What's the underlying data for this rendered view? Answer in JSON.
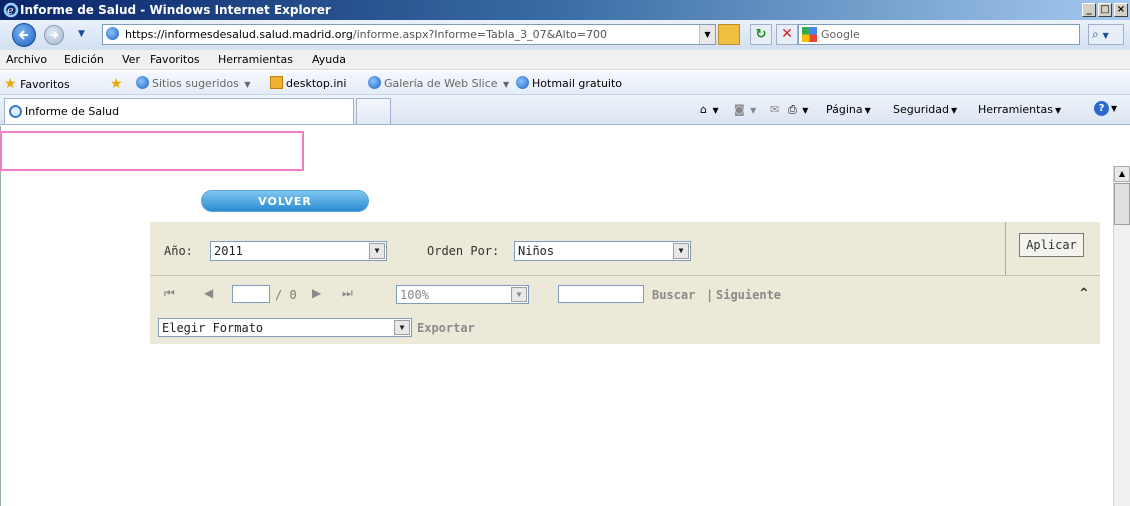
{
  "window": {
    "title": "Informe de Salud - Windows Internet Explorer"
  },
  "address": {
    "host": "https://informesdesalud.salud.madrid.org",
    "path": "/informe.aspx?Informe=Tabla_3_07&Alto=700"
  },
  "search": {
    "placeholder": "Google"
  },
  "menu": [
    "Archivo",
    "Edición",
    "Ver",
    "Favoritos",
    "Herramientas",
    "Ayuda"
  ],
  "favorites": {
    "label": "Favoritos",
    "items": [
      "Sitios sugeridos",
      "desktop.ini",
      "Galería de Web Slice",
      "Hotmail gratuito"
    ]
  },
  "tab": {
    "label": "Informe de Salud"
  },
  "commands": [
    "Página",
    "Seguridad",
    "Herramientas"
  ],
  "report": {
    "volver": "VOLVER",
    "year_label": "Año:",
    "year_value": "2011",
    "order_label": "Orden Por:",
    "order_value": "Niños",
    "apply": "Aplicar",
    "page_total": "/ 0",
    "zoom": "100%",
    "buscar": "Buscar",
    "separator": "|",
    "siguiente": "Siguiente",
    "format": "Elegir Formato",
    "exportar": "Exportar"
  },
  "colors": {
    "panel": "#ece9d8",
    "highlight": "#ee7ec8",
    "volver": "#2a8ad0"
  }
}
